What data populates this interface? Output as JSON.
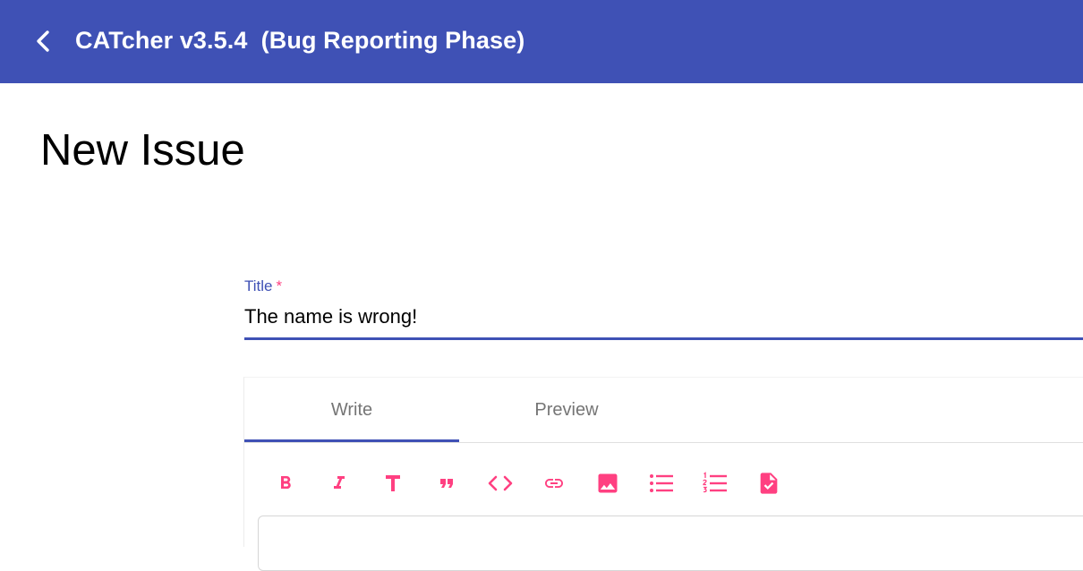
{
  "app_bar": {
    "title": "CATcher v3.5.4  (Bug Reporting Phase)",
    "background_color": "#3f51b5",
    "back_icon": "chevron-left-icon"
  },
  "page": {
    "heading": "New Issue"
  },
  "title_field": {
    "label": "Title",
    "required_marker": "*",
    "value": "The name is wrong!"
  },
  "editor": {
    "tabs": [
      {
        "label": "Write",
        "active": true
      },
      {
        "label": "Preview",
        "active": false
      }
    ],
    "toolbar_icons": [
      "bold-icon",
      "italic-icon",
      "heading-icon",
      "quote-icon",
      "code-icon",
      "link-icon",
      "image-icon",
      "bulleted-list-icon",
      "numbered-list-icon",
      "task-list-icon"
    ],
    "accent_color": "#ff4081"
  }
}
